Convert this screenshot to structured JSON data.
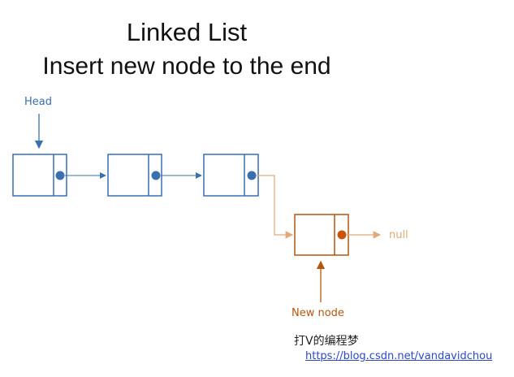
{
  "title": {
    "line1": "Linked List",
    "line2": "Insert new node to the end"
  },
  "labels": {
    "head": "Head",
    "null": "null",
    "new_node": "New node"
  },
  "watermark": {
    "text": "打V的编程梦",
    "url": "https://blog.csdn.net/vandavidchou"
  },
  "colors": {
    "list_node": "#3a6fb0",
    "new_node": "#b3570f",
    "null_arrow": "#e3a97a",
    "pointer_line": "#e3a97a"
  }
}
